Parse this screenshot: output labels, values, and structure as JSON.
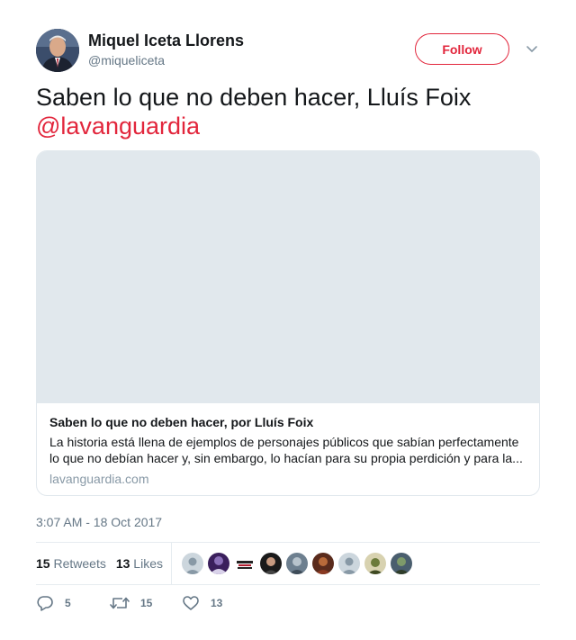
{
  "author": {
    "display_name": "Miquel Iceta Llorens",
    "handle": "@miqueliceta",
    "avatar_icon": "profile-photo"
  },
  "follow_label": "Follow",
  "tweet": {
    "text": "Saben lo que no deben hacer, Lluís Foix",
    "mention": "@lavanguardia"
  },
  "card": {
    "title": "Saben lo que no deben hacer, por Lluís Foix",
    "description_line1": "La historia está llena de ejemplos de personajes públicos que sabían perfectamente",
    "description_line2": "lo que no debían hacer y, sin embargo, lo hacían para su propia perdición y para la...",
    "domain": "lavanguardia.com"
  },
  "timestamp": "3:07 AM - 18 Oct 2017",
  "stats": {
    "retweets_count": "15",
    "retweets_label": "Retweets",
    "likes_count": "13",
    "likes_label": "Likes"
  },
  "actions": {
    "reply_count": "5",
    "retweet_count": "15",
    "like_count": "13"
  },
  "colors": {
    "accent": "#e2263c",
    "secondary_text": "#657786",
    "border": "#e6ecf0"
  }
}
